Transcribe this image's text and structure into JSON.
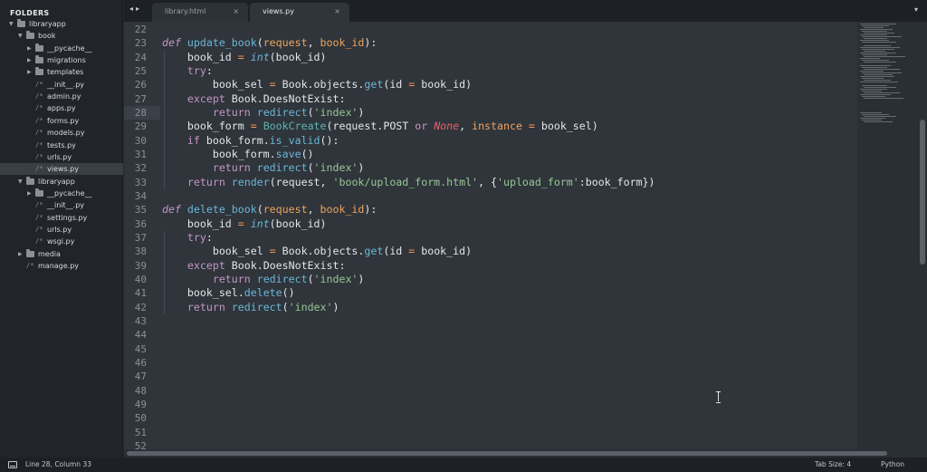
{
  "sidebar": {
    "header": "FOLDERS",
    "tree": [
      {
        "label": "libraryapp",
        "type": "folder",
        "expanded": true,
        "depth": 0
      },
      {
        "label": "book",
        "type": "folder",
        "expanded": true,
        "depth": 1
      },
      {
        "label": "__pycache__",
        "type": "folder",
        "expanded": false,
        "depth": 2
      },
      {
        "label": "migrations",
        "type": "folder",
        "expanded": false,
        "depth": 2
      },
      {
        "label": "templates",
        "type": "folder",
        "expanded": false,
        "depth": 2
      },
      {
        "label": "__init__.py",
        "type": "file",
        "depth": 2
      },
      {
        "label": "admin.py",
        "type": "file",
        "depth": 2
      },
      {
        "label": "apps.py",
        "type": "file",
        "depth": 2
      },
      {
        "label": "forms.py",
        "type": "file",
        "depth": 2
      },
      {
        "label": "models.py",
        "type": "file",
        "depth": 2
      },
      {
        "label": "tests.py",
        "type": "file",
        "depth": 2
      },
      {
        "label": "urls.py",
        "type": "file",
        "depth": 2
      },
      {
        "label": "views.py",
        "type": "file",
        "depth": 2,
        "selected": true
      },
      {
        "label": "libraryapp",
        "type": "folder",
        "expanded": true,
        "depth": 1
      },
      {
        "label": "__pycache__",
        "type": "folder",
        "expanded": false,
        "depth": 2
      },
      {
        "label": "__init__.py",
        "type": "file",
        "depth": 2
      },
      {
        "label": "settings.py",
        "type": "file",
        "depth": 2
      },
      {
        "label": "urls.py",
        "type": "file",
        "depth": 2
      },
      {
        "label": "wsgi.py",
        "type": "file",
        "depth": 2
      },
      {
        "label": "media",
        "type": "folder",
        "expanded": false,
        "depth": 1
      },
      {
        "label": "manage.py",
        "type": "file",
        "depth": 1
      }
    ]
  },
  "tabs": {
    "nav_back": "◂",
    "nav_forward": "▸",
    "items": [
      {
        "label": "library.html",
        "active": false,
        "close": "×"
      },
      {
        "label": "views.py",
        "active": true,
        "close": "×"
      }
    ],
    "dropdown": "▾"
  },
  "editor": {
    "highlighted_line": 28,
    "line_numbers": [
      "22",
      "23",
      "24",
      "25",
      "26",
      "27",
      "28",
      "29",
      "30",
      "31",
      "32",
      "33",
      "34",
      "35",
      "36",
      "37",
      "38",
      "39",
      "40",
      "41",
      "42",
      "43",
      "44",
      "45",
      "46",
      "47",
      "48",
      "49",
      "50",
      "51",
      "52"
    ],
    "code_lines": [
      [],
      [
        [
          "kwi",
          "def "
        ],
        [
          "fn",
          "update_book"
        ],
        [
          "",
          "("
        ],
        [
          "pm",
          "request"
        ],
        [
          "",
          ", "
        ],
        [
          "pm",
          "book_id"
        ],
        [
          "",
          "):"
        ]
      ],
      [
        [
          "",
          "    book_id "
        ],
        [
          "op",
          "="
        ],
        [
          "",
          ""
        ],
        [
          "builtin",
          " int"
        ],
        [
          "",
          "(book_id)"
        ]
      ],
      [
        [
          "kw",
          "    try"
        ],
        [
          "",
          ":"
        ]
      ],
      [
        [
          "",
          "        book_sel "
        ],
        [
          "op",
          "="
        ],
        [
          "",
          " Book.objects."
        ],
        [
          "fn",
          "get"
        ],
        [
          "",
          "(id "
        ],
        [
          "op",
          "="
        ],
        [
          "",
          " book_id)"
        ]
      ],
      [
        [
          "kw",
          "    except"
        ],
        [
          "",
          " Book.DoesNotExist:"
        ]
      ],
      [
        [
          "kw",
          "        return"
        ],
        [
          "",
          " "
        ],
        [
          "fn",
          "redirect"
        ],
        [
          "",
          "("
        ],
        [
          "st",
          "'index'"
        ],
        [
          "",
          ")"
        ]
      ],
      [
        [
          "",
          "    book_form "
        ],
        [
          "op",
          "="
        ],
        [
          "",
          " "
        ],
        [
          "fn2",
          "BookCreate"
        ],
        [
          "",
          "(request.POST "
        ],
        [
          "kw",
          "or"
        ],
        [
          "",
          " "
        ],
        [
          "it",
          "None"
        ],
        [
          "",
          ", "
        ],
        [
          "pm",
          "instance"
        ],
        [
          "",
          " "
        ],
        [
          "op",
          "="
        ],
        [
          "",
          " book_sel)"
        ]
      ],
      [
        [
          "kw",
          "    if"
        ],
        [
          "",
          " book_form."
        ],
        [
          "fn",
          "is_valid"
        ],
        [
          "",
          "():"
        ]
      ],
      [
        [
          "",
          "        book_form."
        ],
        [
          "fn",
          "save"
        ],
        [
          "",
          "()"
        ]
      ],
      [
        [
          "kw",
          "        return"
        ],
        [
          "",
          " "
        ],
        [
          "fn",
          "redirect"
        ],
        [
          "",
          "("
        ],
        [
          "st",
          "'index'"
        ],
        [
          "",
          ")"
        ]
      ],
      [
        [
          "kw",
          "    return"
        ],
        [
          "",
          " "
        ],
        [
          "fn",
          "render"
        ],
        [
          "",
          "(request, "
        ],
        [
          "st",
          "'book/upload_form.html'"
        ],
        [
          "",
          ", {"
        ],
        [
          "st",
          "'upload_form'"
        ],
        [
          "",
          ":book_form})"
        ]
      ],
      [],
      [
        [
          "kwi",
          "def "
        ],
        [
          "fn",
          "delete_book"
        ],
        [
          "",
          "("
        ],
        [
          "pm",
          "request"
        ],
        [
          "",
          ", "
        ],
        [
          "pm",
          "book_id"
        ],
        [
          "",
          "):"
        ]
      ],
      [
        [
          "",
          "    book_id "
        ],
        [
          "op",
          "="
        ],
        [
          "",
          ""
        ],
        [
          "builtin",
          " int"
        ],
        [
          "",
          "(book_id)"
        ]
      ],
      [
        [
          "kw",
          "    try"
        ],
        [
          "",
          ":"
        ]
      ],
      [
        [
          "",
          "        book_sel "
        ],
        [
          "op",
          "="
        ],
        [
          "",
          " Book.objects."
        ],
        [
          "fn",
          "get"
        ],
        [
          "",
          "(id "
        ],
        [
          "op",
          "="
        ],
        [
          "",
          " book_id)"
        ]
      ],
      [
        [
          "kw",
          "    except"
        ],
        [
          "",
          " Book.DoesNotExist:"
        ]
      ],
      [
        [
          "kw",
          "        return"
        ],
        [
          "",
          " "
        ],
        [
          "fn",
          "redirect"
        ],
        [
          "",
          "("
        ],
        [
          "st",
          "'index'"
        ],
        [
          "",
          ")"
        ]
      ],
      [
        [
          "",
          "    book_sel."
        ],
        [
          "fn",
          "delete"
        ],
        [
          "",
          "()"
        ]
      ],
      [
        [
          "kw",
          "    return"
        ],
        [
          "",
          " "
        ],
        [
          "fn",
          "redirect"
        ],
        [
          "",
          "("
        ],
        [
          "st",
          "'index'"
        ],
        [
          "",
          ")"
        ]
      ],
      [],
      [],
      [],
      [],
      [],
      [],
      [],
      [],
      [],
      []
    ]
  },
  "statusbar": {
    "position": "Line 28, Column 33",
    "tab_size": "Tab Size: 4",
    "syntax": "Python"
  }
}
